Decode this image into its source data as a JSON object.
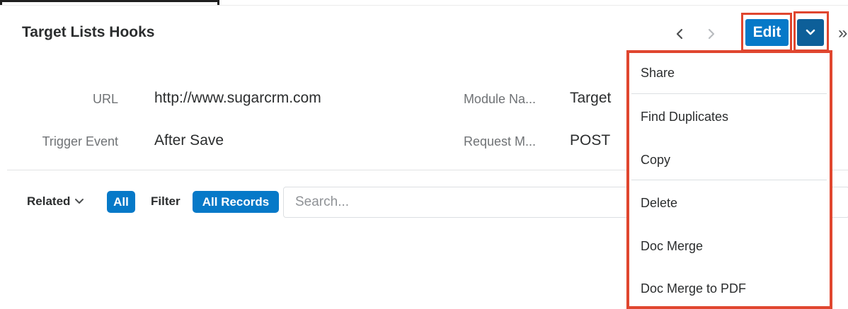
{
  "header": {
    "title": "Target Lists Hooks",
    "edit_label": "Edit",
    "icons": {
      "prev": "chevron-left-icon",
      "next": "chevron-right-icon",
      "dropdown": "chevron-down-icon",
      "more": "double-chevron-right-icon"
    },
    "more_glyph": "»"
  },
  "fields": {
    "url": {
      "label": "URL",
      "value": "http://www.sugarcrm.com"
    },
    "module_name": {
      "label": "Module Na...",
      "value": "Target"
    },
    "trigger_event": {
      "label": "Trigger Event",
      "value": "After Save"
    },
    "request_method": {
      "label": "Request M...",
      "value": "POST"
    }
  },
  "subpanel": {
    "related_label": "Related",
    "related_filter": "All",
    "filter_label": "Filter",
    "filter_value": "All Records",
    "search_placeholder": "Search..."
  },
  "dropdown": {
    "items": [
      {
        "label": "Share"
      },
      {
        "label": "Find Duplicates"
      },
      {
        "label": "Copy"
      },
      {
        "label": "Delete"
      },
      {
        "label": "Doc Merge"
      },
      {
        "label": "Doc Merge to PDF"
      }
    ]
  },
  "colors": {
    "accent": "#0679c8",
    "accent_dark": "#0d5f99",
    "highlight": "#e0462f"
  }
}
